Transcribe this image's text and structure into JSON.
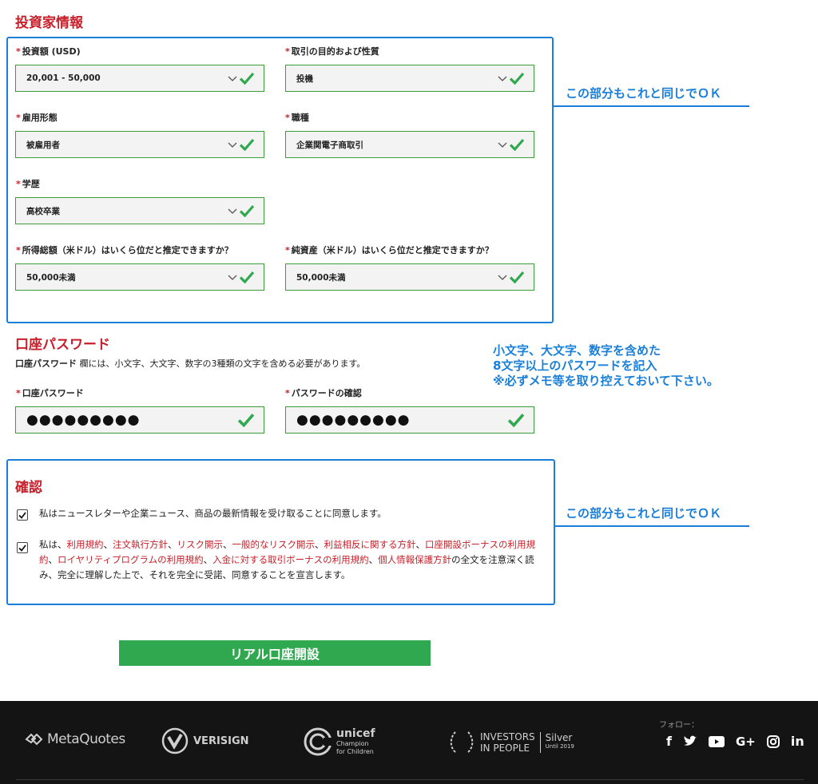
{
  "investor": {
    "title": "投資家情報",
    "fields": [
      {
        "label": "投資額 (USD)",
        "value": "20,001 - 50,000"
      },
      {
        "label": "取引の目的および性質",
        "value": "投機"
      },
      {
        "label": "雇用形態",
        "value": "被雇用者"
      },
      {
        "label": "職種",
        "value": "企業関電子商取引"
      },
      {
        "label": "学歴",
        "value": "高校卒業"
      },
      {
        "label": "所得総額（米ドル）はいくら位だと推定できますか？",
        "value": "50,000未満"
      },
      {
        "label": "純資産（米ドル）はいくら位だと推定できますか？",
        "value": "50,000未満"
      }
    ],
    "required_mark": "*"
  },
  "password": {
    "title": "口座パスワード",
    "desc_bold": "口座パスワード",
    "desc_rest": " 欄には、小文字、大文字、数字の3種類の文字を含める必要があります。",
    "field1_label": "口座パスワード",
    "field1_value": "●●●●●●●●●",
    "field2_label": "パスワードの確認",
    "field2_value": "●●●●●●●●●"
  },
  "confirm": {
    "title": "確認",
    "newsletter": "私はニュースレターや企業ニュース、商品の最新情報を受け取ることに同意します。",
    "terms": {
      "prefix": "私は、",
      "links": [
        "利用規約",
        "注文執行方針",
        "リスク開示",
        "一般的なリスク開示",
        "利益相反に関する方針",
        "口座開設ボーナスの利用規約",
        "ロイヤリティプログラムの利用規約",
        "入金に対する取引ボーナスの利用規約",
        "個人情報保護方針"
      ],
      "sep": "、",
      "suffix": "の全文を注意深く読み、完全に理解した上で、それを完全に受諾、同意することを宣言します。"
    }
  },
  "annotations": {
    "same_ok_1": "この部分もこれと同じでＯＫ",
    "same_ok_2": "この部分もこれと同じでＯＫ",
    "pw_note_1": "小文字、大文字、数字を含めた",
    "pw_note_2": "8文字以上のパスワードを記入",
    "pw_note_3": "※必ずメモ等を取り控えておいて下さい。"
  },
  "submit_label": "リアル口座開設",
  "footer": {
    "follow_label": "フォロー：",
    "metaquotes": "MetaQuotes",
    "verisign": "VERISIGN",
    "unicef": "unicef",
    "unicef_sub1": "Champion",
    "unicef_sub2": "for Children",
    "iip1": "INVESTORS",
    "iip2": "IN PEOPLE",
    "iip_silver": "Silver",
    "iip_until": "Until 2019",
    "social": [
      "f",
      "G+",
      "in"
    ]
  },
  "colors": {
    "accent_red": "#c8202a",
    "frame_blue": "#1a7fd8",
    "ok_green": "#2fa84f",
    "footer_bg": "#141414"
  }
}
